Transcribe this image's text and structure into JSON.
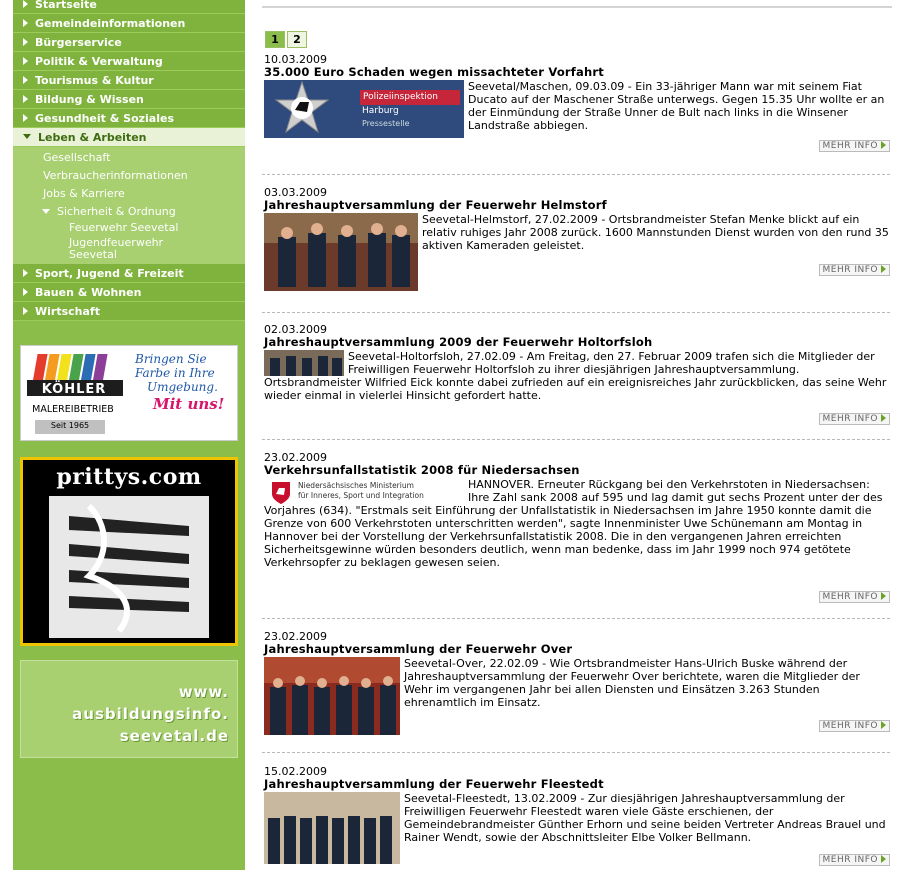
{
  "sidebar": {
    "items_top": [
      {
        "label": "Startseite"
      },
      {
        "label": "Gemeindeinformationen"
      },
      {
        "label": "Bürgerservice"
      },
      {
        "label": "Politik & Verwaltung"
      },
      {
        "label": "Tourismus & Kultur"
      },
      {
        "label": "Bildung & Wissen"
      },
      {
        "label": "Gesundheit & Soziales"
      },
      {
        "label": "Leben & Arbeiten"
      }
    ],
    "sub_items": [
      {
        "label": "Gesellschaft"
      },
      {
        "label": "Verbraucherinformationen"
      },
      {
        "label": "Jobs & Karriere"
      },
      {
        "label": "Sicherheit & Ordnung"
      }
    ],
    "subsub_items": [
      {
        "label": "Feuerwehr Seevetal"
      },
      {
        "label": "Jugendfeuerwehr Seevetal"
      }
    ],
    "items_bottom": [
      {
        "label": "Sport, Jugend & Freizeit"
      },
      {
        "label": "Bauen & Wohnen"
      },
      {
        "label": "Wirtschaft"
      }
    ]
  },
  "ads": {
    "koehler": {
      "name": "KÖHLER",
      "line1": "MALEREIBETRIEB",
      "line2": "Seit 1965",
      "slogan1": "Bringen Sie",
      "slogan2": "Farbe in Ihre",
      "slogan3": "Umgebung.",
      "slogan4": "Mit uns!"
    },
    "prittys": {
      "title": "prittys.com"
    },
    "ausbildung": {
      "line1": "www.",
      "line2": "ausbildungsinfo.",
      "line3": "seevetal.de"
    }
  },
  "pager": {
    "pages": [
      "1",
      "2"
    ]
  },
  "more_label": "MEHR INFO",
  "articles": [
    {
      "date": "10.03.2009",
      "title": "35.000 Euro Schaden wegen missachteter Vorfahrt",
      "body": "Seevetal/Maschen, 09.03.09 - Ein 33-jähriger Mann war mit seinem Fiat Ducato auf der Maschener Straße unterwegs. Gegen 15.35 Uhr wollte er an der Einmündung der Straße Unner de Bult nach links in die Winsener Landstraße abbiegen.",
      "image_text": [
        "Polizeiinspektion",
        "Harburg",
        "Pressestelle"
      ]
    },
    {
      "date": "03.03.2009",
      "title": "Jahreshauptversammlung der Feuerwehr Helmstorf",
      "body": "Seevetal-Helmstorf, 27.02.2009 - Ortsbrandmeister Stefan Menke blickt auf ein relativ ruhiges Jahr 2008 zurück. 1600 Mannstunden Dienst wurden von den rund 35 aktiven Kameraden geleistet."
    },
    {
      "date": "02.03.2009",
      "title": "Jahreshauptversammlung 2009 der Feuerwehr Holtorfsloh",
      "body": "Seevetal-Holtorfsloh, 27.02.09 - Am Freitag, den 27. Februar 2009 trafen sich die Mitglieder der Freiwilligen Feuerwehr Holtorfsloh zu ihrer diesjährigen Jahreshauptversammlung. Ortsbrandmeister Wilfried Eick konnte dabei zufrieden auf ein ereignisreiches Jahr zurückblicken, das seine Wehr wieder einmal in vielerlei Hinsicht gefordert hatte."
    },
    {
      "date": "23.02.2009",
      "title": "Verkehrsunfallstatistik 2008 für Niedersachsen",
      "body": "HANNOVER. Erneuter Rückgang bei den Verkehrstoten in Niedersachsen: Ihre Zahl sank 2008 auf 595 und lag damit gut sechs Prozent unter der des Vorjahres (634). \"Erstmals seit Einführung der Unfallstatistik in Niedersachsen im Jahre 1950 konnte damit die Grenze von 600 Verkehrstoten unterschritten werden\", sagte Innenminister Uwe Schünemann am Montag in Hannover bei der Vorstellung der Verkehrsunfallstatistik 2008. Die in den vergangenen Jahren erreichten Sicherheitsgewinne würden besonders deutlich, wenn man bedenke, dass im Jahr 1999 noch 974 getötete Verkehrsopfer zu beklagen gewesen seien.",
      "image_text": [
        "Niedersächsisches Ministerium",
        "für Inneres, Sport und Integration"
      ]
    },
    {
      "date": "23.02.2009",
      "title": "Jahreshauptversammlung der Feuerwehr Over",
      "body": "Seevetal-Over, 22.02.09 - Wie Ortsbrandmeister Hans-Ulrich Buske während der Jahreshauptversammlung der Feuerwehr Over berichtete, waren die Mitglieder der Wehr im vergangenen Jahr bei allen Diensten und Einsätzen 3.263 Stunden ehrenamtlich im Einsatz."
    },
    {
      "date": "15.02.2009",
      "title": "Jahreshauptversammlung der Feuerwehr Fleestedt",
      "body": "Seevetal-Fleestedt, 13.02.2009 - Zur diesjährigen Jahreshauptversammlung der Freiwilligen Feuerwehr Fleestedt waren viele Gäste erschienen, der Gemeindebrandmeister Günther Erhorn und seine beiden Vertreter Andreas Brauel und Rainer Wendt, sowie der Abschnittsleiter Elbe Volker Bellmann."
    }
  ]
}
